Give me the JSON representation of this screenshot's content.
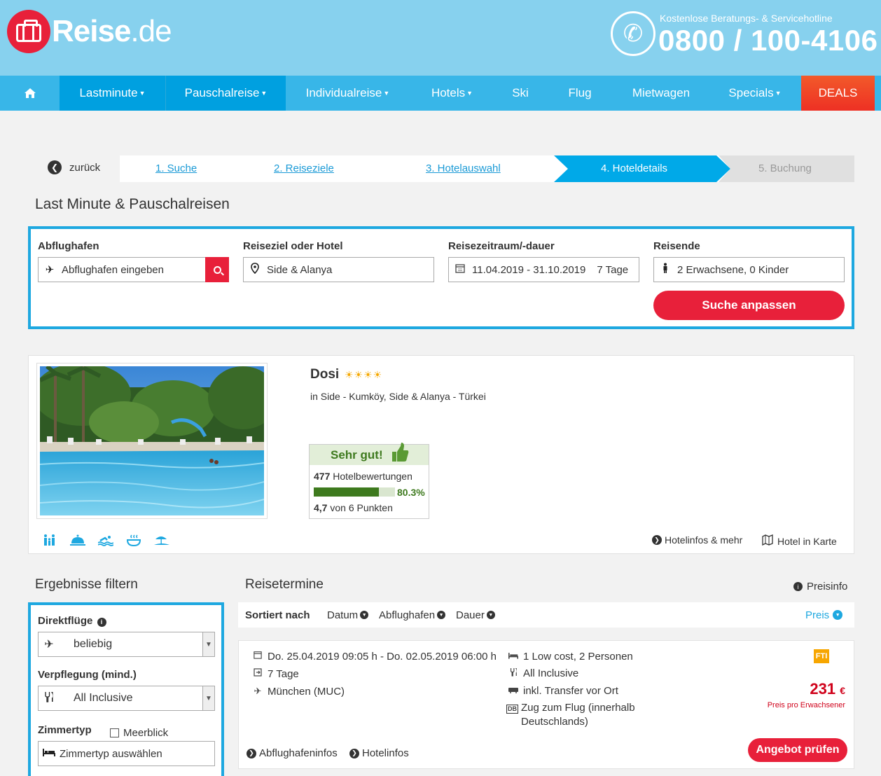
{
  "brand": {
    "logo_bold": "Reise",
    "logo_light": ".de",
    "brand_color": "#e8203a"
  },
  "hotline": {
    "label": "Kostenlose Beratungs- & Servicehotline",
    "number": "0800 / 100-4106"
  },
  "nav": {
    "home_icon": "home-icon",
    "items": [
      {
        "label": "Lastminute",
        "dropdown": true
      },
      {
        "label": "Pauschalreise",
        "dropdown": true
      },
      {
        "label": "Individualreise",
        "dropdown": true
      },
      {
        "label": "Hotels",
        "dropdown": true
      },
      {
        "label": "Ski",
        "dropdown": false
      },
      {
        "label": "Flug",
        "dropdown": false
      },
      {
        "label": "Mietwagen",
        "dropdown": false
      },
      {
        "label": "Specials",
        "dropdown": true
      },
      {
        "label": "DEALS",
        "dropdown": false
      }
    ]
  },
  "breadcrumb": {
    "back": "zurück",
    "steps": [
      "1. Suche",
      "2. Reiseziele",
      "3. Hotelauswahl",
      "4. Hoteldetails",
      "5. Buchung"
    ]
  },
  "page_title": "Last Minute & Pauschalreisen",
  "search": {
    "departure_label": "Abflughafen",
    "departure_placeholder": "Abflughafen eingeben",
    "destination_label": "Reiseziel oder Hotel",
    "destination_value": "Side & Alanya",
    "period_label": "Reisezeitraum/-dauer",
    "period_value": "11.04.2019 - 31.10.2019",
    "duration_value": "7 Tage",
    "travellers_label": "Reisende",
    "travellers_value": "2 Erwachsene, 0 Kinder",
    "submit": "Suche anpassen"
  },
  "hotel": {
    "name": "Dosi",
    "stars": "☀☀☀☀",
    "location": "in Side - Kumköy, Side & Alanya - Türkei",
    "rating_label": "Sehr gut!",
    "reviews_count": "477",
    "reviews_label": "Hotelbewertungen",
    "recommend_pct": 80.3,
    "recommend_pct_text": "80.3%",
    "score": "4,7",
    "score_suffix": "von 6 Punkten",
    "amenities": [
      "family-icon",
      "room-service-icon",
      "swimming-icon",
      "spa-icon",
      "beach-icon"
    ],
    "links": {
      "info": "Hotelinfos & mehr",
      "map": "Hotel in Karte"
    }
  },
  "filter": {
    "title": "Ergebnisse filtern",
    "direct_label": "Direktflüge",
    "direct_value": "beliebig",
    "board_label": "Verpflegung (mind.)",
    "board_value": "All Inclusive",
    "room_label": "Zimmertyp",
    "seaview_label": "Meerblick",
    "room_placeholder": "Zimmertyp auswählen"
  },
  "results": {
    "title": "Reisetermine",
    "preisinfo": "Preisinfo",
    "sort_label": "Sortiert nach",
    "sort_options": [
      "Datum",
      "Abflughafen",
      "Dauer",
      "Preis"
    ],
    "offer": {
      "dates": "Do. 25.04.2019 09:05 h - Do. 02.05.2019 06:00 h",
      "duration": "7 Tage",
      "airport": "München (MUC)",
      "room": "1 Low cost, 2 Personen",
      "board": "All Inclusive",
      "transfer": "inkl. Transfer vor Ort",
      "train": "Zug zum Flug (innerhalb Deutschlands)",
      "train_badge": "DB",
      "operator_logo": "FTI",
      "price": "231",
      "currency": "€",
      "price_note": "Preis pro Erwachsener",
      "airport_info": "Abflughafeninfos",
      "hotel_info": "Hotelinfos",
      "cta": "Angebot prüfen"
    }
  }
}
